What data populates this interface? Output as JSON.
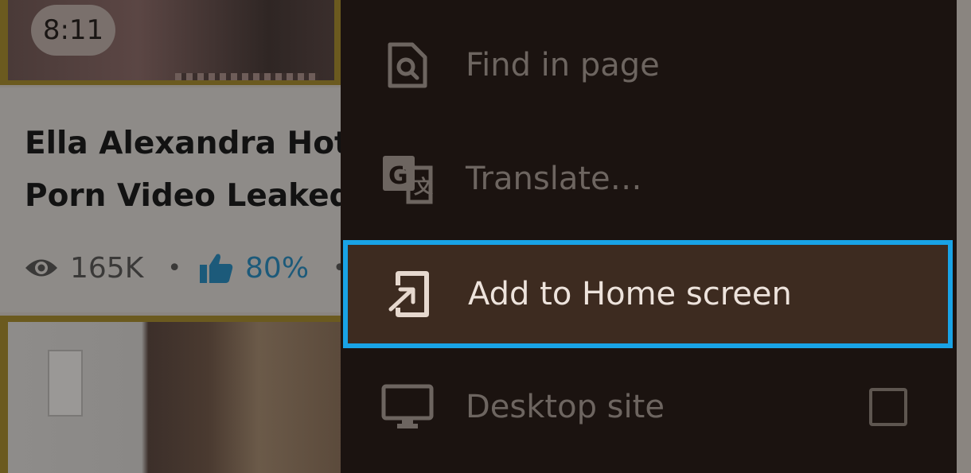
{
  "background_page": {
    "video_duration": "8:11",
    "video_title": "Ella Alexandra Hot\nPorn Video Leaked",
    "views": "165K",
    "separator": "•",
    "rating": "80%"
  },
  "menu": {
    "items": [
      {
        "label": "Find in page",
        "icon": "find-in-page-icon"
      },
      {
        "label": "Translate…",
        "icon": "translate-icon"
      },
      {
        "label": "Add to Home screen",
        "icon": "add-to-home-screen-icon",
        "highlighted": true
      },
      {
        "label": "Desktop site",
        "icon": "desktop-icon",
        "checkbox_checked": false
      }
    ]
  },
  "colors": {
    "menu_background": "#1b1310",
    "highlight_border": "#19a3e6",
    "highlight_background": "#3d2b20",
    "card_border": "#6b5a1f",
    "rating_text": "#1c5a7a"
  }
}
